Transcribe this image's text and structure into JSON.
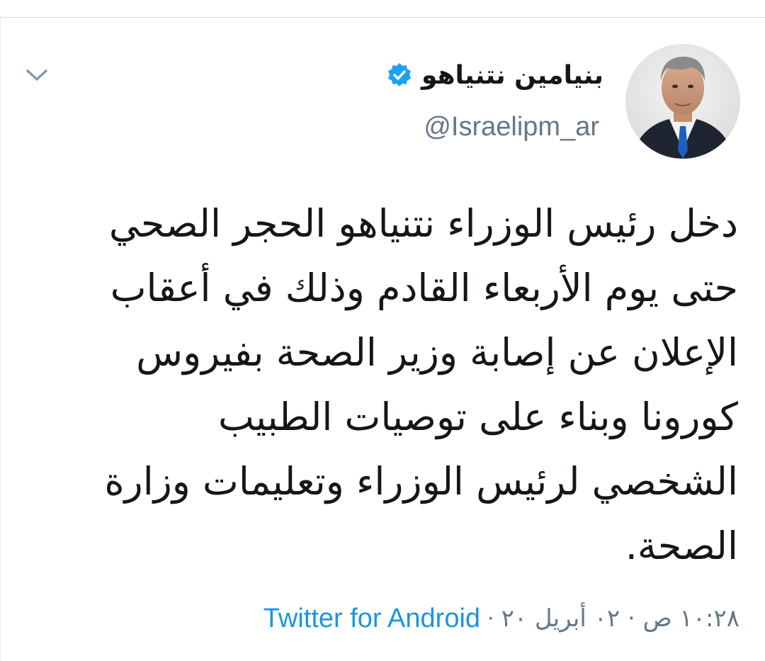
{
  "author": {
    "display_name": "بنيامين نتنياهو",
    "handle": "@Israelipm_ar",
    "verified": true,
    "avatar_icon": "person-portrait"
  },
  "tweet": {
    "lines": [
      "دخل رئيس الوزراء نتنياهو الحجر الصحي",
      "حتى يوم الأربعاء القادم وذلك في أعقاب",
      "الإعلان عن إصابة وزير الصحة بفيروس",
      "كورونا وبناء على توصيات الطبيب",
      "الشخصي لرئيس الوزراء وتعليمات وزارة",
      "الصحة."
    ],
    "timestamp": "١٠:٢٨ ص · ٠٢ أبريل ٢٠",
    "separator": "·",
    "source": "Twitter for Android"
  },
  "icons": {
    "menu": "chevron-down-icon",
    "verified": "verified-badge-icon"
  },
  "colors": {
    "text": "#14171a",
    "secondary": "#657786",
    "link": "#1b95e0",
    "verified": "#1da1f2"
  }
}
